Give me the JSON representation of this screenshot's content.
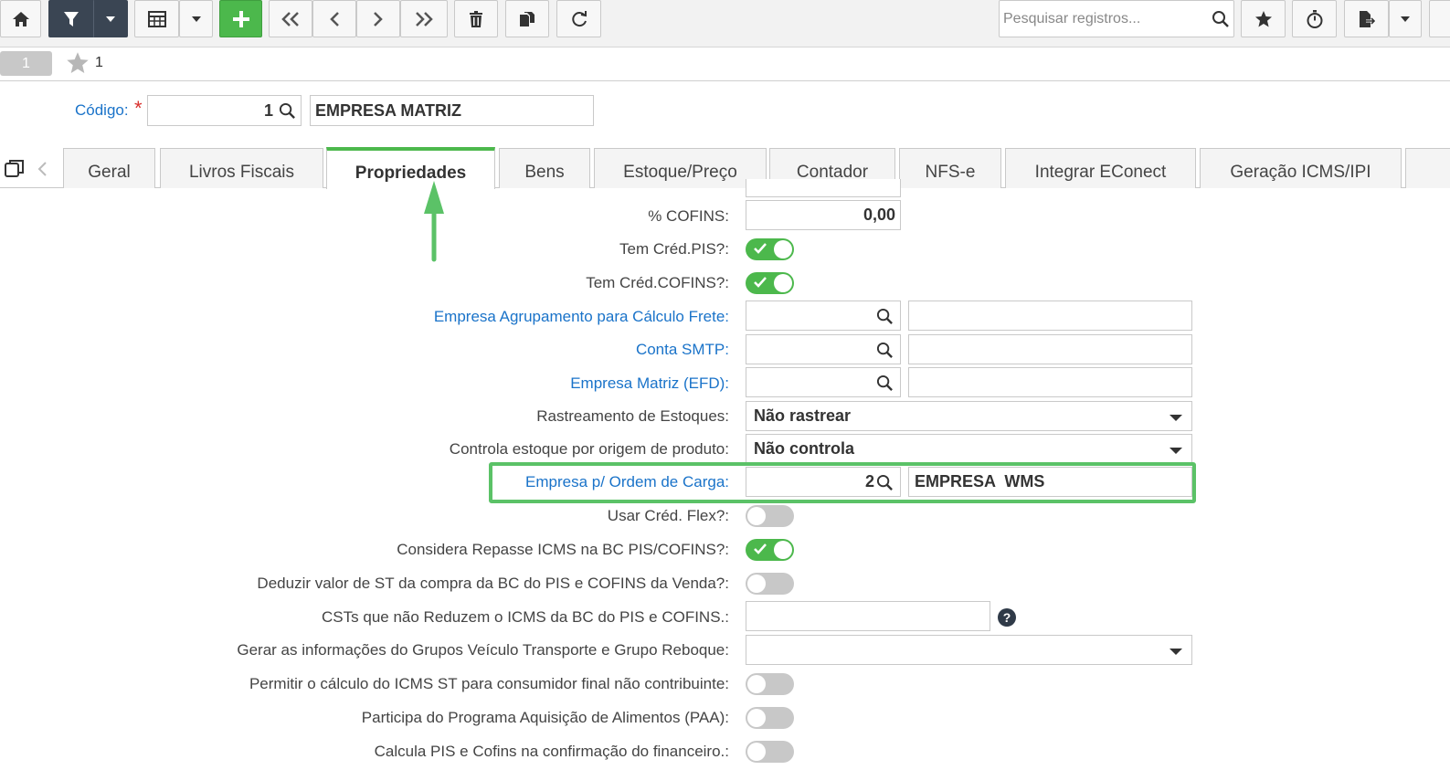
{
  "toolbar": {
    "search_placeholder": "Pesquisar registros...",
    "icons": [
      "home-icon",
      "filter-icon",
      "caret-down-icon",
      "grid-icon",
      "caret-down-icon",
      "plus-icon",
      "first-icon",
      "prev-icon",
      "next-icon",
      "last-icon",
      "trash-icon",
      "copy-icon",
      "refresh-icon",
      "search-icon",
      "star-icon",
      "timer-icon",
      "export-icon",
      "caret-down-icon"
    ],
    "colors": {
      "dark": "#3a4553",
      "green": "#4cb84c"
    }
  },
  "record_bar": {
    "pill": "1",
    "count": "1"
  },
  "codigo": {
    "label": "Código:",
    "required_mark": "*",
    "value": "1",
    "name": "EMPRESA MATRIZ"
  },
  "tabs": [
    {
      "label": "Geral"
    },
    {
      "label": "Livros Fiscais"
    },
    {
      "label": "Propriedades",
      "active": true
    },
    {
      "label": "Bens"
    },
    {
      "label": "Estoque/Preço"
    },
    {
      "label": "Contador"
    },
    {
      "label": "NFS-e"
    },
    {
      "label": "Integrar EConect"
    },
    {
      "label": "Geração ICMS/IPI"
    }
  ],
  "form": {
    "cofins_label": "% COFINS:",
    "cofins_value": "0,00",
    "tem_cred_pis_label": "Tem Créd.PIS?:",
    "tem_cred_pis": true,
    "tem_cred_cofins_label": "Tem Créd.COFINS?:",
    "tem_cred_cofins": true,
    "empresa_agrup_label": "Empresa Agrupamento para Cálculo Frete:",
    "conta_smtp_label": "Conta SMTP:",
    "empresa_matriz_efd_label": "Empresa Matriz (EFD):",
    "rastreamento_label": "Rastreamento de Estoques:",
    "rastreamento_value": "Não rastrear",
    "controla_estoque_label": "Controla estoque por origem de produto:",
    "controla_estoque_value": "Não controla",
    "empresa_ordem_label": "Empresa p/ Ordem de Carga:",
    "empresa_ordem_code": "2",
    "empresa_ordem_name": "EMPRESA  WMS",
    "usar_cred_flex_label": "Usar Créd. Flex?:",
    "usar_cred_flex": false,
    "considera_repasse_label": "Considera Repasse ICMS na BC PIS/COFINS?:",
    "considera_repasse": true,
    "deduzir_st_label": "Deduzir valor de ST da compra da BC do PIS e COFINS da Venda?:",
    "deduzir_st": false,
    "csts_label": "CSTs que não Reduzem o ICMS da BC do PIS e COFINS.:",
    "help_glyph": "?",
    "gerar_info_label": "Gerar as informações do Grupos Veículo Transporte e Grupo Reboque:",
    "permitir_icms_label": "Permitir o cálculo do ICMS ST para consumidor final não contribuinte:",
    "permitir_icms": false,
    "paa_label": "Participa do Programa Aquisição de Alimentos (PAA):",
    "paa": false,
    "calcula_pis_label": "Calcula PIS e Cofins na confirmação do financeiro.:",
    "calcula_pis": false
  }
}
